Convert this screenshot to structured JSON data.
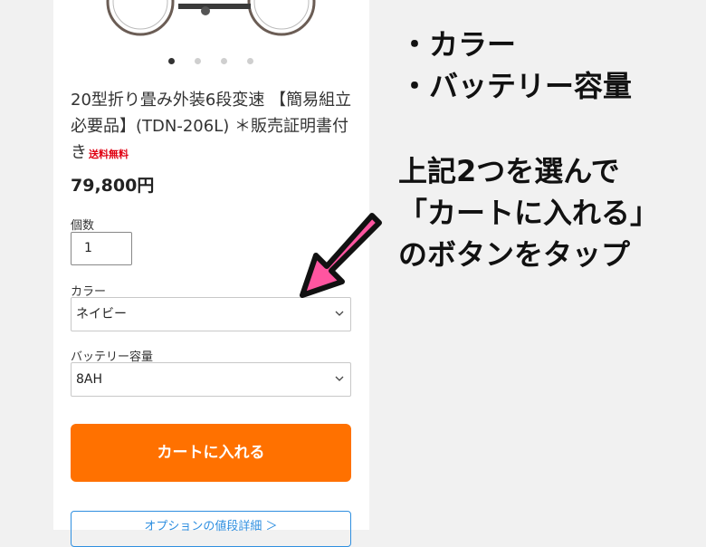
{
  "product": {
    "title": "20型折り畳み外装6段変速 【簡易組立必要品】(TDN-206L) ＊販売証明書付き",
    "shipping_badge": "送料無料",
    "price": "79,800円",
    "carousel_page": "1 of 4"
  },
  "form": {
    "qty_label": "個数",
    "qty_value": "1",
    "color_label": "カラー",
    "color_value": "ネイビー",
    "battery_label": "バッテリー容量",
    "battery_value": "8AH"
  },
  "buttons": {
    "cart": "カートに入れる",
    "option": "オプションの値段詳細 ＞"
  },
  "annotation": {
    "bullet1": "・カラー",
    "bullet2": "・バッテリー容量",
    "line1": "上記2つを選んで",
    "line2": "「カートに入れる」",
    "line3": "のボタンをタップ"
  },
  "colors": {
    "cart_button": "#ff7100",
    "arrow": "#ff55a0",
    "badge": "#e00012",
    "link": "#2f8fe0"
  }
}
